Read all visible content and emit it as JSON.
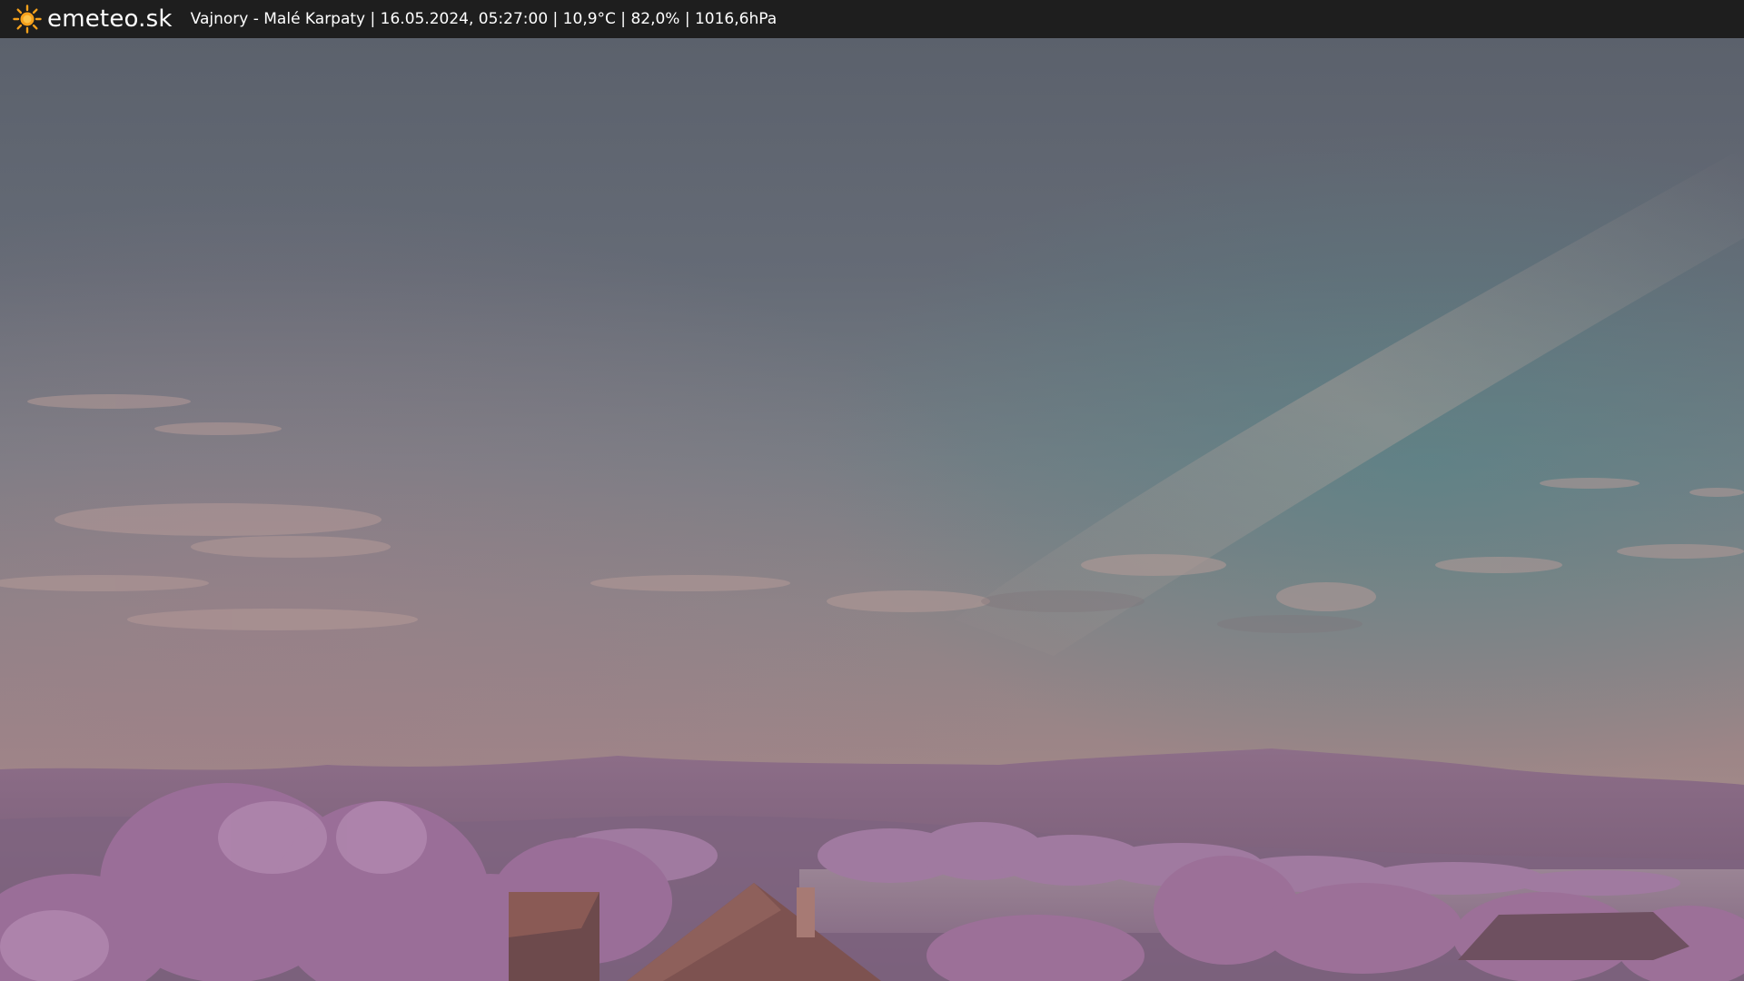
{
  "header": {
    "logo_text": "emeteo.sk",
    "logo_icon": "sun-icon",
    "info_text": "Vajnory - Malé Karpaty | 16.05.2024, 05:27:00 | 10,9°C | 82,0% | 1016,6hPa"
  },
  "colors": {
    "topbar": "#1e1e1e",
    "sun": "#f6a11b",
    "sky_top": "#5e6470",
    "sky_mid": "#7a8085",
    "sky_low": "#8e7a7e",
    "horizon": "#a48883",
    "foliage": "#9a7098",
    "roof": "#8a5a55"
  }
}
